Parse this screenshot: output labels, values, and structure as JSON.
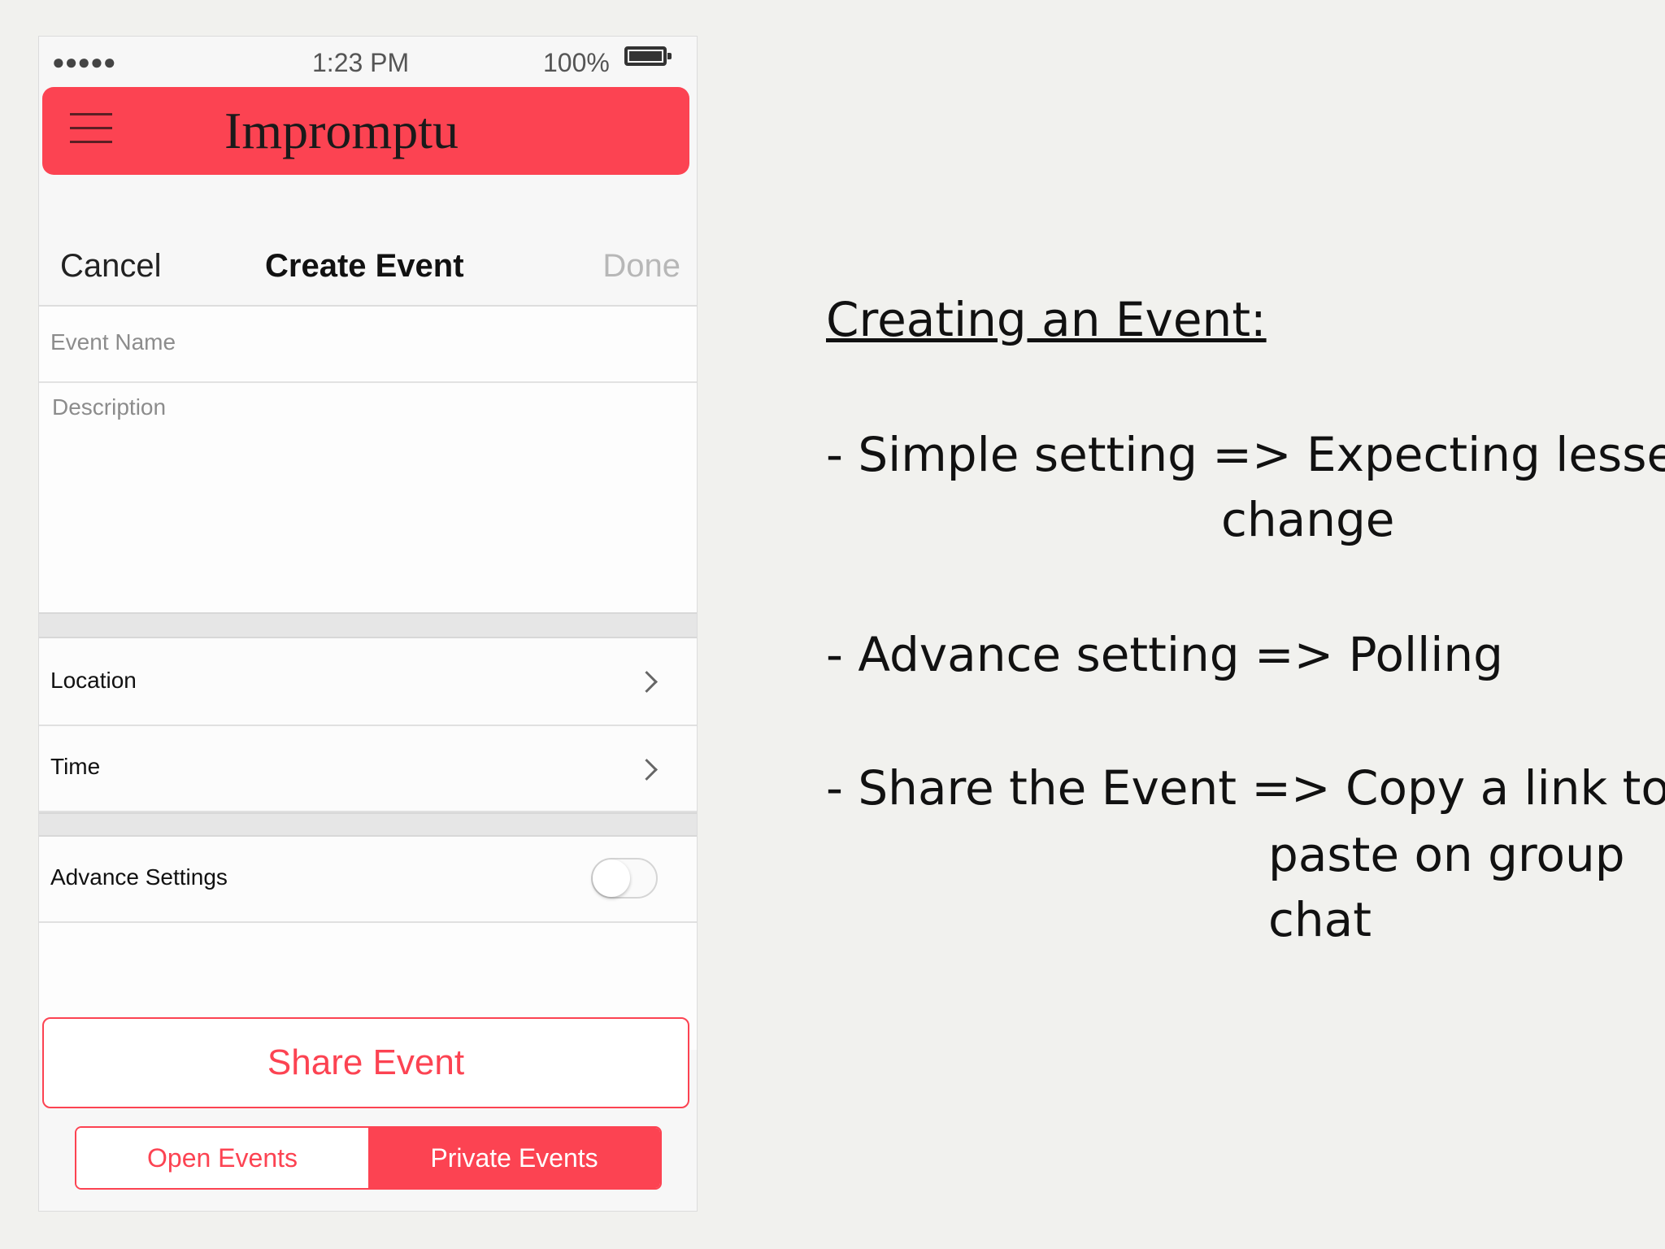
{
  "status_bar": {
    "signal": "●●●●●",
    "time": "1:23 PM",
    "battery_percent": "100%",
    "battery_icon": "battery-full-icon"
  },
  "header": {
    "menu_icon": "hamburger-icon",
    "title": "Impromptu",
    "accent_color": "#fc4352"
  },
  "nav": {
    "cancel_label": "Cancel",
    "title": "Create Event",
    "done_label": "Done"
  },
  "form": {
    "event_name_placeholder": "Event Name",
    "description_placeholder": "Description",
    "rows": [
      {
        "label": "Location",
        "icon": "chevron-right-icon"
      },
      {
        "label": "Time",
        "icon": "chevron-right-icon"
      }
    ],
    "advance_settings": {
      "label": "Advance Settings",
      "toggle_on": false
    }
  },
  "actions": {
    "share_label": "Share Event",
    "tabs": [
      {
        "label": "Open Events",
        "selected": false
      },
      {
        "label": "Private Events",
        "selected": true
      }
    ]
  },
  "notes": {
    "heading": "Creating an Event:",
    "bullets": [
      {
        "lines": [
          "- Simple setting => Expecting lesser",
          "change"
        ]
      },
      {
        "lines": [
          "- Advance setting => Polling"
        ]
      },
      {
        "lines": [
          "- Share the Event => Copy a link to be",
          "paste on group",
          "chat"
        ]
      }
    ]
  }
}
